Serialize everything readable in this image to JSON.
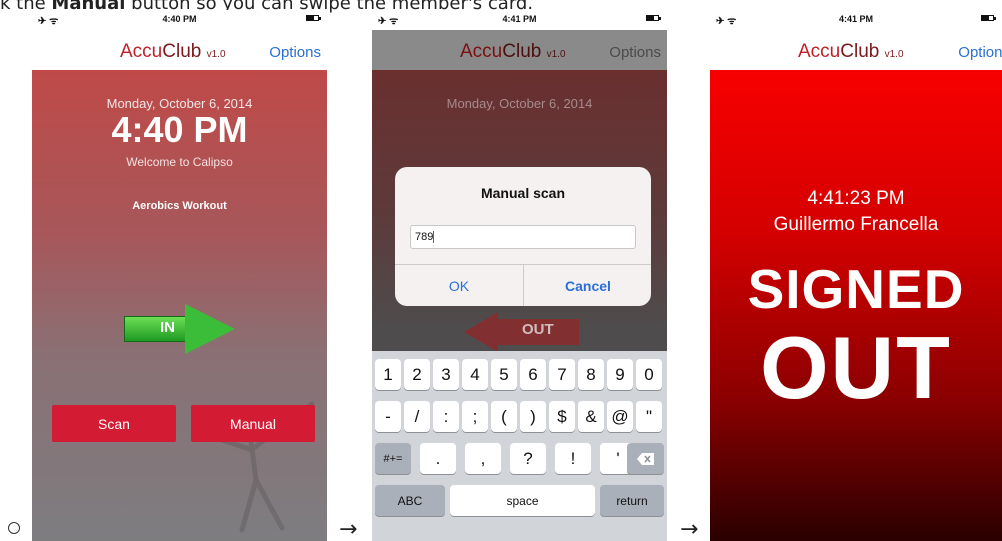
{
  "instruction": {
    "prefix": "k the ",
    "emphasis": "Manual",
    "suffix": " button so you can swipe the member's card."
  },
  "separators": {
    "arrow": "→"
  },
  "screen1": {
    "status_time": "4:40 PM",
    "brand": {
      "accu": "Accu",
      "club": "Club",
      "version": "v1.0"
    },
    "options_label": "Options",
    "date": "Monday, October 6, 2014",
    "clock": "4:40 PM",
    "welcome": "Welcome to Calipso",
    "workout": "Aerobics Workout",
    "in_label": "IN",
    "scan_label": "Scan",
    "manual_label": "Manual"
  },
  "screen2": {
    "status_time": "4:41 PM",
    "brand": {
      "accu": "Accu",
      "club": "Club",
      "version": "v1.0"
    },
    "options_label": "Options",
    "date": "Monday, October 6, 2014",
    "alert_title": "Manual scan",
    "alert_input_value": "789",
    "ok_label": "OK",
    "cancel_label": "Cancel",
    "out_label": "OUT",
    "keyboard": {
      "row1": [
        "1",
        "2",
        "3",
        "4",
        "5",
        "6",
        "7",
        "8",
        "9",
        "0"
      ],
      "row2": [
        "-",
        "/",
        ":",
        ";",
        "(",
        ")",
        "$",
        "&",
        "@",
        "\""
      ],
      "row3_left": "#+=",
      "row3": [
        ".",
        ",",
        "?",
        "!",
        "'"
      ],
      "abc": "ABC",
      "space": "space",
      "return": "return"
    }
  },
  "screen3": {
    "status_time": "4:41 PM",
    "brand": {
      "accu": "Accu",
      "club": "Club",
      "version": "v1.0"
    },
    "options_label": "Options",
    "time": "4:41:23 PM",
    "member_name": "Guillermo Francella",
    "signed_label": "SIGNED",
    "out_label": "OUT"
  }
}
